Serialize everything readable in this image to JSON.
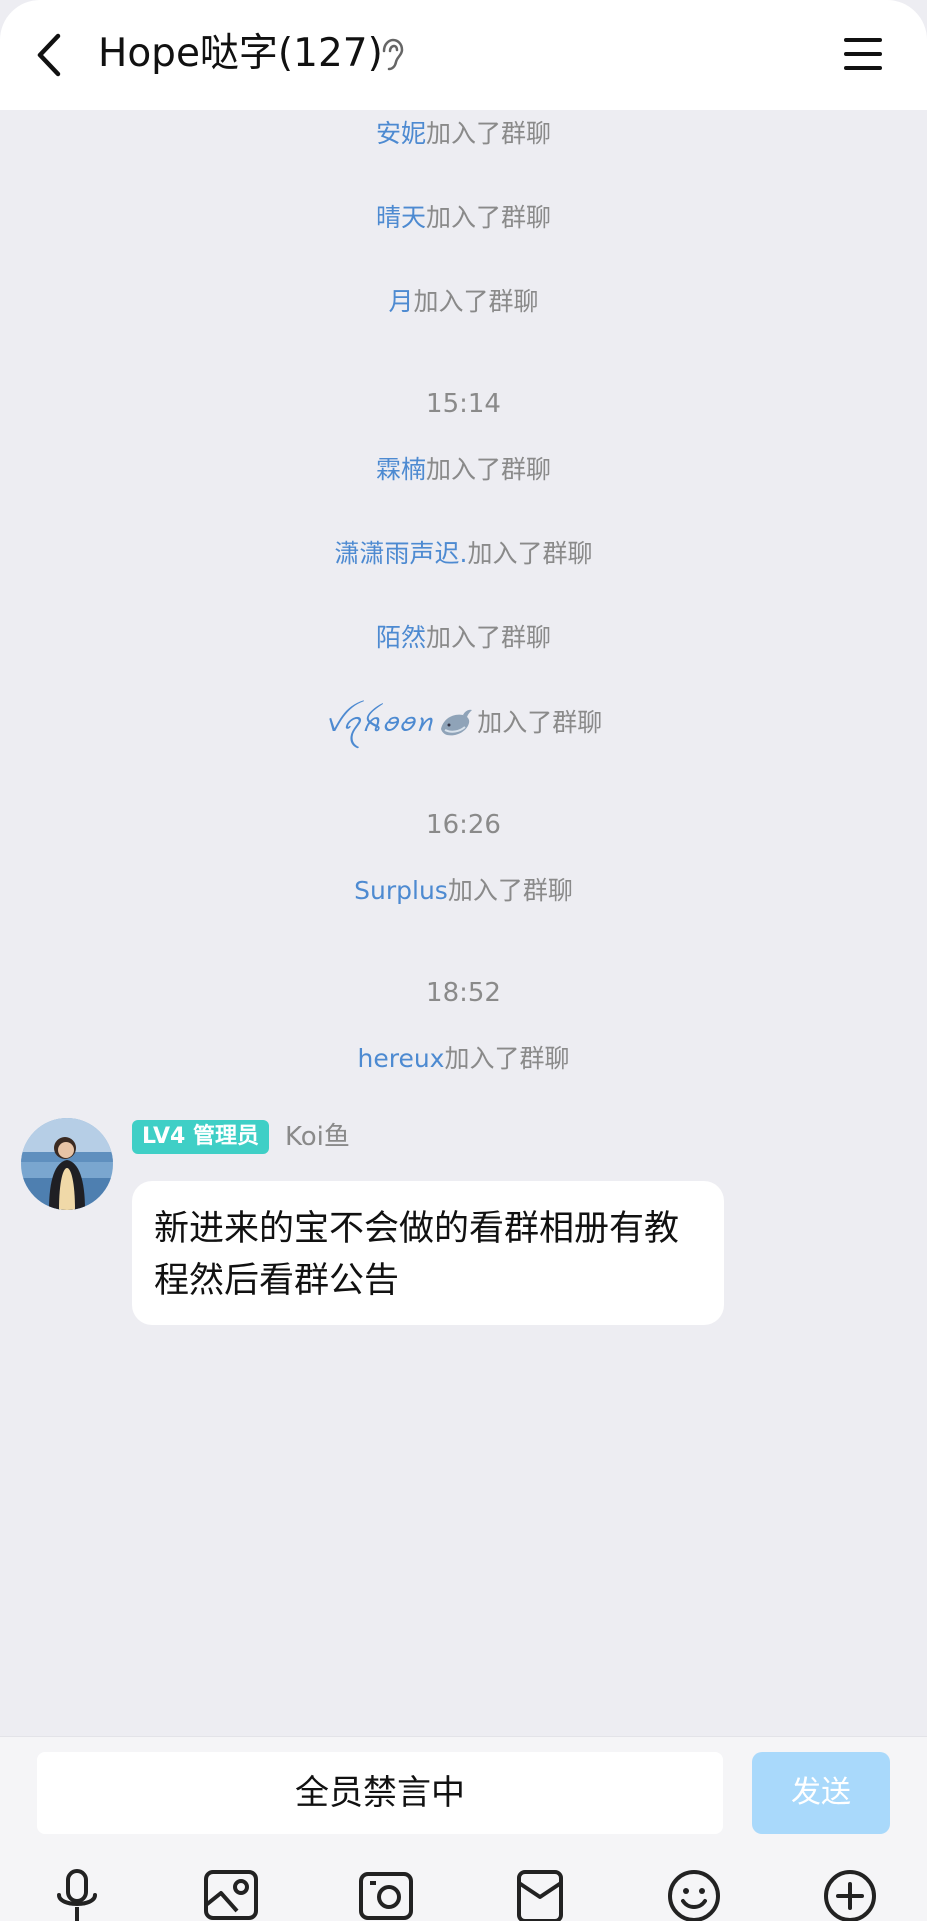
{
  "header": {
    "title": "Hope哒字(127)",
    "back_icon": "chevron-left-icon",
    "ear_icon": "ear-icon",
    "menu_icon": "menu-icon"
  },
  "messages": {
    "join_suffix": "加入了群聊",
    "joins_group1": [
      {
        "name": "安妮"
      },
      {
        "name": "晴天"
      },
      {
        "name": "月"
      }
    ],
    "time1": "15:14",
    "joins_group2": [
      {
        "name": "霖楠"
      },
      {
        "name": "潇潇雨声迟."
      },
      {
        "name": "陌然"
      },
      {
        "name": "ꪜꪖꫝꪮꪮꪀ"
      }
    ],
    "time2": "16:26",
    "join_surplus": {
      "name": "Surplus"
    },
    "time3": "18:52",
    "join_hereux": {
      "name": "hereux"
    },
    "chat_message": {
      "badge": "LV4 管理员",
      "sender": "Koi鱼",
      "text": "新进来的宝不会做的看群相册有教程然后看群公告"
    }
  },
  "input": {
    "status": "全员禁言中",
    "send_label": "发送",
    "send_color": "#a9d9fb"
  },
  "toolbar": {
    "icons": [
      "microphone-icon",
      "image-icon",
      "camera-icon",
      "red-packet-icon",
      "emoji-icon",
      "plus-icon"
    ]
  }
}
